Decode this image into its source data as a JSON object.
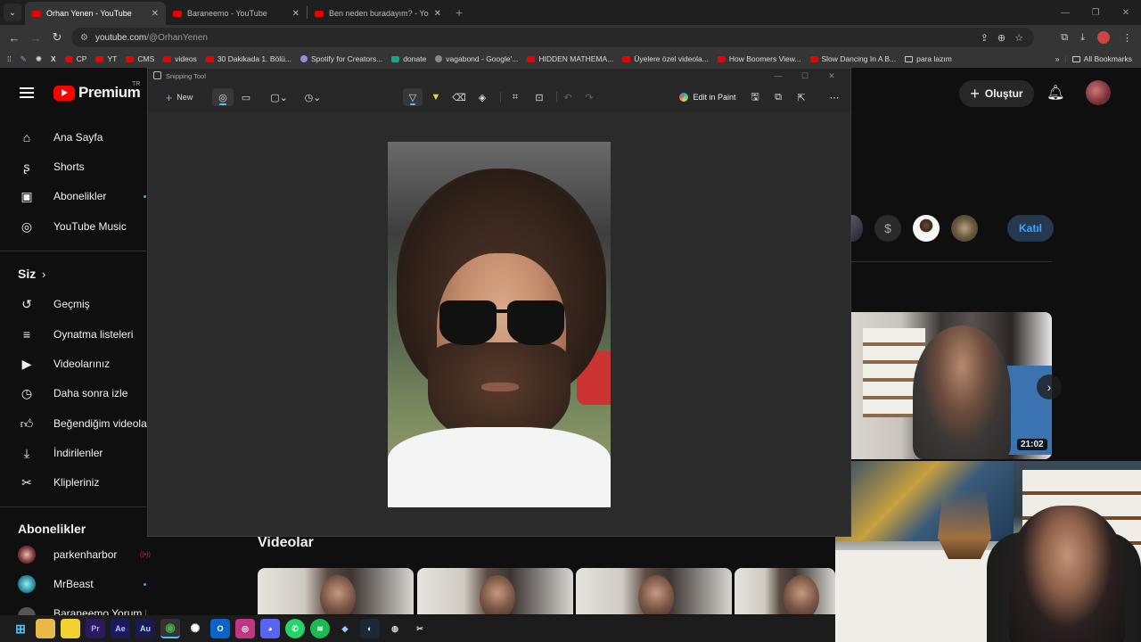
{
  "browser": {
    "tabs": [
      {
        "title": "Orhan Yenen - YouTube",
        "active": true
      },
      {
        "title": "Baraneemo - YouTube",
        "active": false
      },
      {
        "title": "Ben neden buradayım? - YouTu",
        "active": false
      }
    ],
    "url": "youtube.com/@OrhanYenen",
    "url_host": "youtube.com",
    "url_path": "/@OrhanYenen",
    "bookmarks": [
      {
        "label": "CP",
        "icon": "youtube"
      },
      {
        "label": "YT",
        "icon": "youtube"
      },
      {
        "label": "CMS",
        "icon": "youtube"
      },
      {
        "label": "videos",
        "icon": "youtube"
      },
      {
        "label": "30 Dakikada 1. Bölü...",
        "icon": "youtube"
      },
      {
        "label": "Spotify for Creators...",
        "icon": "spotify"
      },
      {
        "label": "donate",
        "icon": "sheets"
      },
      {
        "label": "vagabond - Google'...",
        "icon": "google"
      },
      {
        "label": "HIDDEN MATHEMA...",
        "icon": "youtube"
      },
      {
        "label": "Üyelere özel videola...",
        "icon": "youtube"
      },
      {
        "label": "How Boomers View...",
        "icon": "youtube"
      },
      {
        "label": "Slow Dancing In A B...",
        "icon": "youtube"
      },
      {
        "label": "para lazım",
        "icon": "folder"
      }
    ],
    "all_bookmarks": "All Bookmarks"
  },
  "youtube": {
    "logo_text": "Premium",
    "country": "TR",
    "create_label": "Oluştur",
    "nav": [
      {
        "label": "Ana Sayfa",
        "icon": "home-icon"
      },
      {
        "label": "Shorts",
        "icon": "shorts-icon"
      },
      {
        "label": "Abonelikler",
        "icon": "subscriptions-icon"
      },
      {
        "label": "YouTube Music",
        "icon": "music-icon"
      }
    ],
    "you_header": "Siz",
    "you_items": [
      {
        "label": "Geçmiş",
        "icon": "history-icon"
      },
      {
        "label": "Oynatma listeleri",
        "icon": "playlist-icon"
      },
      {
        "label": "Videolarınız",
        "icon": "your-videos-icon"
      },
      {
        "label": "Daha sonra izle",
        "icon": "watch-later-icon"
      },
      {
        "label": "Beğendiğim videolar",
        "icon": "liked-icon"
      },
      {
        "label": "İndirilenler",
        "icon": "download-icon"
      },
      {
        "label": "Klipleriniz",
        "icon": "clips-icon"
      }
    ],
    "subs_header": "Abonelikler",
    "subs": [
      {
        "label": "parkenharbor"
      },
      {
        "label": "MrBeast"
      },
      {
        "label": "Baraneemo Yorum K"
      }
    ],
    "join_label": "Katıl",
    "featured_duration": "21:02",
    "videos_header": "Videolar"
  },
  "snipping": {
    "title": "Snipping Tool",
    "new_label": "New",
    "edit_in_paint": "Edit in Paint"
  },
  "colors": {
    "accent_blue": "#3ea6ff",
    "youtube_red": "#ff0000",
    "snip_accent": "#4cc2ff"
  }
}
